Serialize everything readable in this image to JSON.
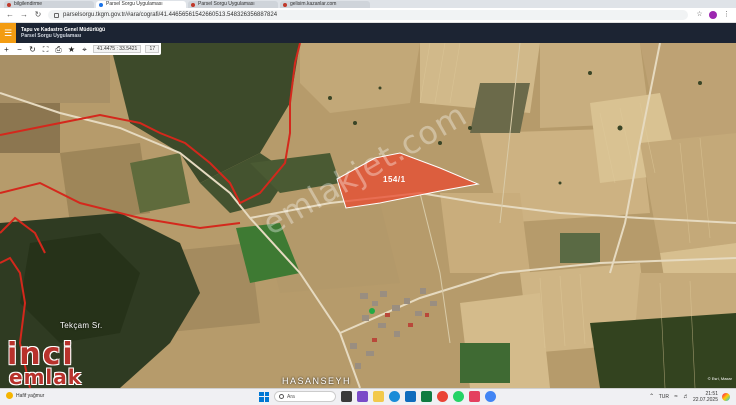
{
  "browser": {
    "tabs": [
      {
        "label": "bilgilendirme"
      },
      {
        "label": "Parsel Sorgu Uygulaması"
      },
      {
        "label": "Parsel Sorgu Uygulaması"
      },
      {
        "label": "gelisim.kazanlar.com"
      }
    ],
    "url": "parselsorgu.tkgm.gov.tr/#ara/cografi/41.44656561542660513.548326356887824"
  },
  "app": {
    "organization": "Tapu ve Kadastro Genel Müdürlüğü",
    "name": "Parsel Sorgu Uygulaması",
    "coordinates": "41.4475 : 33.5421",
    "zoom_level": "17"
  },
  "map": {
    "parcel_label": "154/1",
    "place_labels": [
      "Tekçam Sr.",
      "HASANSEYH"
    ],
    "watermark": "emlakjet.com",
    "attribution": "© Esri, Maxar"
  },
  "logo": {
    "line1": "inci",
    "line2": "emlak"
  },
  "taskbar": {
    "weather": "Hafif yağmur",
    "search_placeholder": "Ara",
    "language": "TUR",
    "time": "21:51",
    "date": "22.07.2025"
  },
  "colors": {
    "parcel_fill": "#e8492f",
    "boundary": "#d4281c",
    "header": "#1c2433",
    "menu_accent": "#f39c12"
  }
}
